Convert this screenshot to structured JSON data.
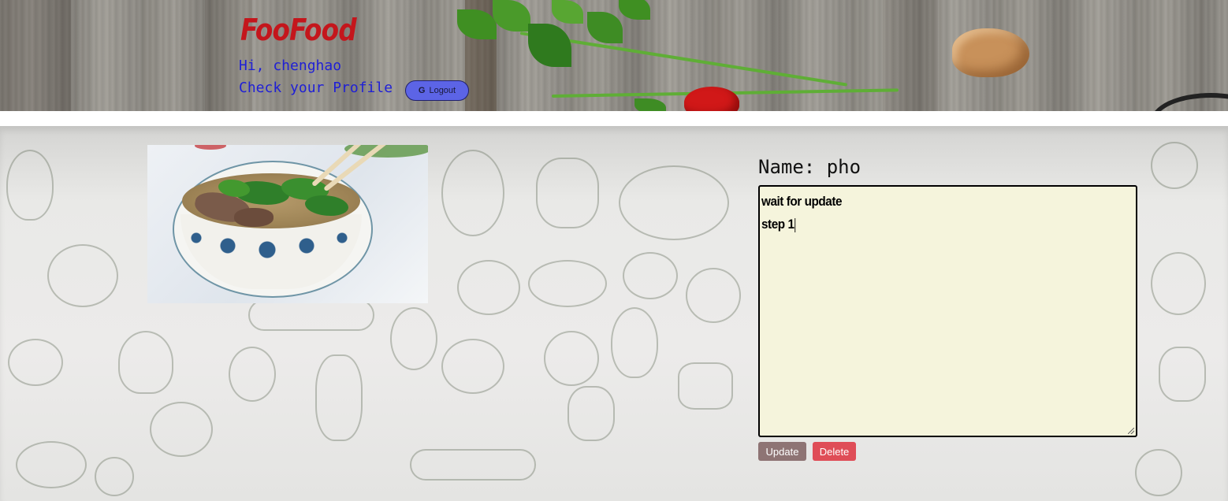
{
  "header": {
    "brand": "FooFood",
    "greeting": "Hi, chenghao",
    "profile_link": "Check your Profile",
    "logout_label": "Logout",
    "logout_icon": "google-icon"
  },
  "recipe": {
    "name_label": "Name: pho",
    "image_alt": "pho",
    "lines": [
      "wait for update",
      "step 1"
    ],
    "update_label": "Update",
    "delete_label": "Delete"
  },
  "colors": {
    "brand": "#c4161c",
    "link": "#1f1fd6",
    "logout_bg": "#5c64e6",
    "textarea_bg": "#f5f4dc",
    "update_bg": "#8e7474",
    "delete_bg": "#df4d57"
  }
}
